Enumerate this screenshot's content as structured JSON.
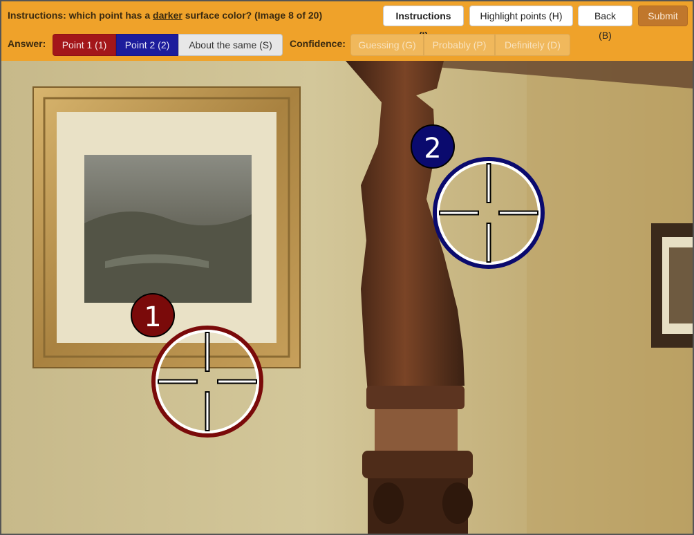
{
  "instructions": {
    "prefix": "Instructions: which point has a ",
    "keyword": "darker",
    "suffix": " surface color? (Image 8 of 20)"
  },
  "toolbar": {
    "instructions_button": "Instructions (I)",
    "highlight_button": "Highlight points (H)",
    "back_button": "Back (B)",
    "submit_button": "Submit"
  },
  "answer": {
    "label": "Answer:",
    "options": [
      "Point 1 (1)",
      "Point 2 (2)",
      "About the same (S)"
    ]
  },
  "confidence": {
    "label": "Confidence:",
    "options": [
      "Guessing (G)",
      "Probably (P)",
      "Definitely (D)"
    ]
  },
  "points": [
    {
      "label": "1",
      "color": "#7a0a0a"
    },
    {
      "label": "2",
      "color": "#0a0a6e"
    }
  ],
  "colors": {
    "toolbar": "#efa22a",
    "point1": "#a3161a",
    "point2": "#1c1c9c",
    "submit": "#c0772c"
  }
}
